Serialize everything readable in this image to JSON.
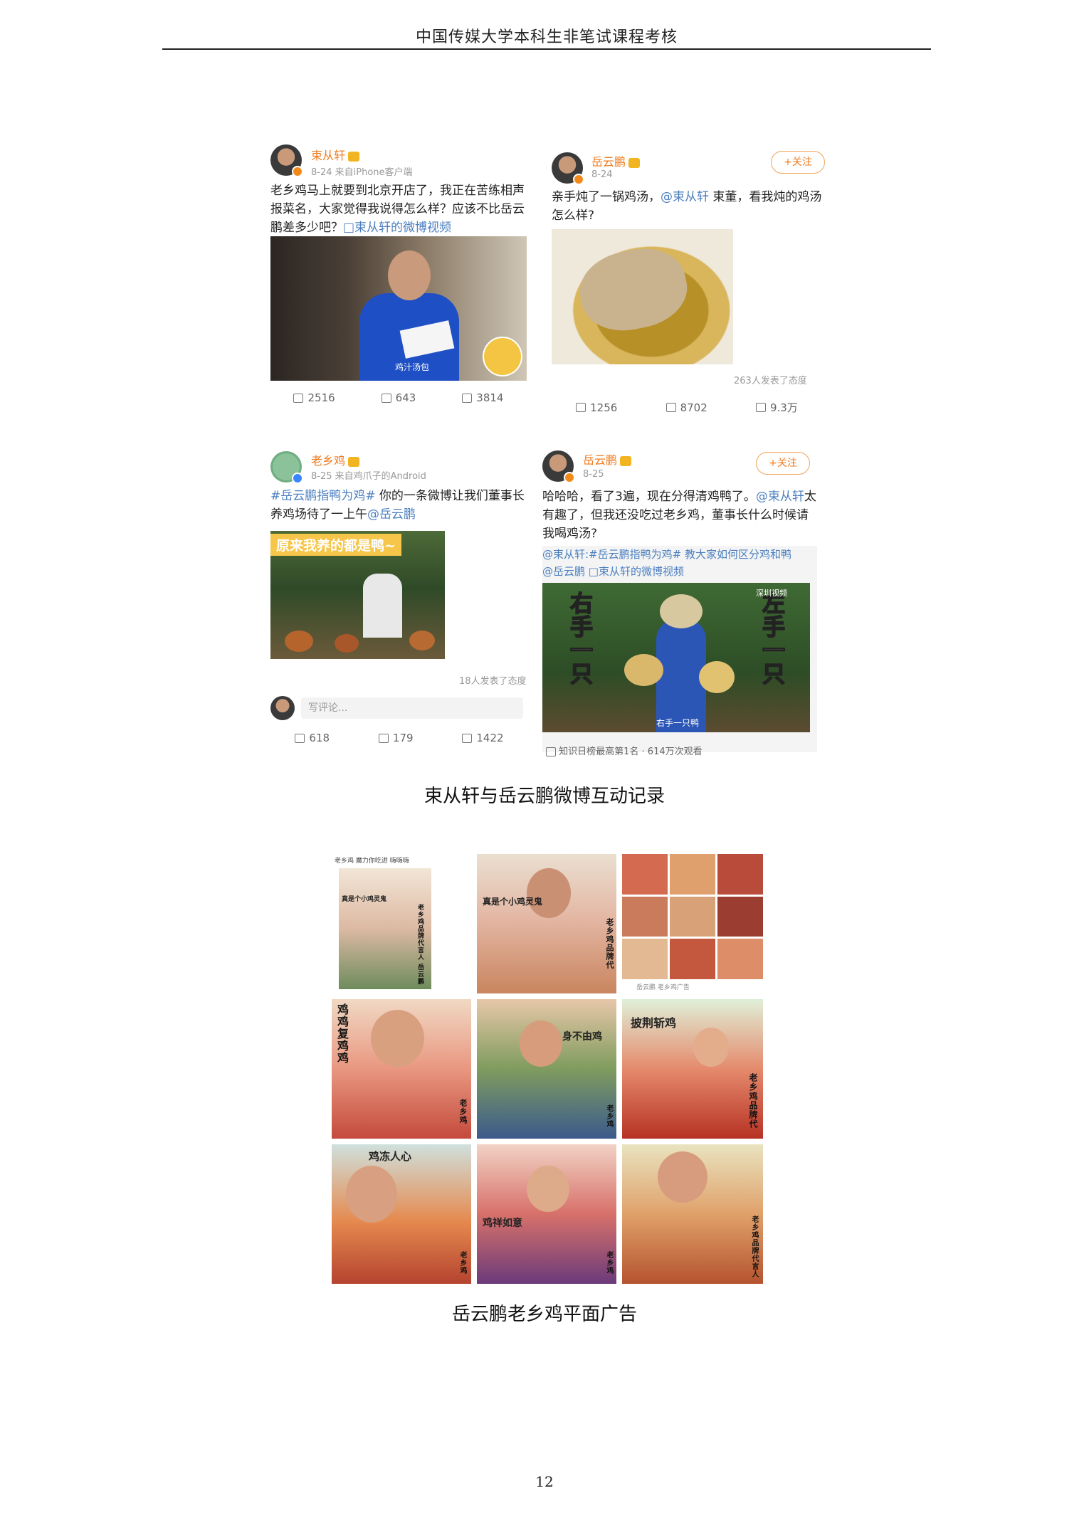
{
  "header": {
    "title": "中国传媒大学本科生非笔试课程考核"
  },
  "posts": {
    "p1": {
      "user": "束从轩",
      "meta": "8-24  来自iPhone客户端",
      "text_a": "老乡鸡马上就要到北京开店了，我正在苦练相声报菜名，大家觉得我说得怎么样？应该不比岳云鹏差多少吧？",
      "link": "□束从轩的微博视频",
      "video_caption": "鸡汁汤包",
      "stats": {
        "repost": "2516",
        "comment": "643",
        "like": "3814"
      }
    },
    "p2": {
      "user": "岳云鹏",
      "meta": "8-24",
      "follow": "+关注",
      "text_a": "亲手炖了一锅鸡汤，",
      "mention": "@束从轩",
      "text_b": " 束董，看我炖的鸡汤怎么样?",
      "reactions": "263人发表了态度",
      "stats": {
        "repost": "1256",
        "comment": "8702",
        "like": "9.3万"
      }
    },
    "p3": {
      "user": "老乡鸡",
      "meta": "8-25  来自鸡爪子的Android",
      "hashtag": "#岳云鹏指鸭为鸡#",
      "text_a": " 你的一条微博让我们董事长养鸡场待了一上午",
      "mention": "@岳云鹏",
      "image_banner": "原来我养的都是鸭~",
      "reactions": "18人发表了态度",
      "comment_placeholder": "写评论...",
      "stats": {
        "repost": "618",
        "comment": "179",
        "like": "1422"
      }
    },
    "p4": {
      "user": "岳云鹏",
      "meta": "8-25",
      "follow": "+关注",
      "text_a": "哈哈哈，看了3遍，现在分得清鸡鸭了。",
      "mention": "@束从轩",
      "text_b": "太有趣了，但我还没吃过老乡鸡，董事长什么时候请我喝鸡汤?",
      "quote": "@束从轩:#岳云鹏指鸭为鸡# 教大家如何区分鸡和鸭",
      "quote_b": "@岳云鹏 □束从轩的微博视频",
      "left_text": "右手一只",
      "right_text": "左手一只",
      "bottom_caption": "右手一只鸭",
      "watermark": "深圳视频",
      "footer": "知识日榜最高第1名 · 614万次观看"
    }
  },
  "caption1": "束从轩与岳云鹏微博互动记录",
  "ads": {
    "t1": {
      "top": "老乡鸡 魔力你吃进 嗨嗨嗨",
      "main": "真是个小鸡灵鬼",
      "side": "老乡鸡品牌代言人 岳云鹏"
    },
    "t2": {
      "main": "真是个小鸡灵鬼",
      "side": "老乡鸡品牌代"
    },
    "t3": {
      "footer": "岳云鹏 老乡鸡广告"
    },
    "t4": {
      "main": "鸡鸡复鸡鸡",
      "side": "老乡鸡"
    },
    "t5": {
      "main": "身不由鸡",
      "side": "老乡鸡"
    },
    "t6": {
      "main": "披荆斩鸡",
      "side": "老乡鸡品牌代"
    },
    "t7": {
      "main": "鸡冻人心",
      "side": "老乡鸡"
    },
    "t8": {
      "main": "鸡祥如意",
      "side": "老乡鸡"
    },
    "t9": {
      "side": "老乡鸡品牌代言人"
    }
  },
  "caption2": "岳云鹏老乡鸡平面广告",
  "page_number": "12"
}
